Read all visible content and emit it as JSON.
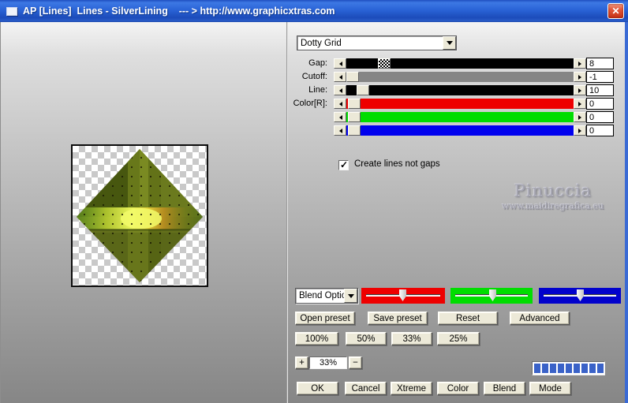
{
  "window": {
    "title": "AP [Lines]  Lines - SilverLining    --- > http://www.graphicxtras.com",
    "close_glyph": "✕"
  },
  "filter": {
    "selected": "Dotty Grid"
  },
  "sliders": {
    "rows": [
      {
        "label": "Gap:",
        "value": "8",
        "track_color": "#000000"
      },
      {
        "label": "Cutoff:",
        "value": "-1",
        "track_color": "#858585"
      },
      {
        "label": "Line:",
        "value": "10",
        "track_color": "#000000"
      },
      {
        "label": "Color[R]:",
        "value": "0",
        "track_color": "#ee0000"
      },
      {
        "label": "",
        "value": "0",
        "track_color": "#00dd00"
      },
      {
        "label": "",
        "value": "0",
        "track_color": "#0000ee"
      }
    ]
  },
  "options": {
    "create_lines_label": "Create lines not gaps",
    "checked": true
  },
  "watermark": {
    "name": "Pinuccia",
    "site": "www.maidiregrafica.eu"
  },
  "blend": {
    "dropdown_label": "Blend Optio",
    "channel_colors": [
      "#ee0000",
      "#00dd00",
      "#0202cc"
    ]
  },
  "presets": {
    "open": "Open preset",
    "save": "Save preset",
    "reset": "Reset",
    "advanced": "Advanced"
  },
  "zoom_presets": [
    "100%",
    "50%",
    "33%",
    "25%"
  ],
  "zoom_control": {
    "plus": "+",
    "value": "33%",
    "minus": "−"
  },
  "progress": {
    "segments": 9,
    "color": "#3a62c8"
  },
  "actions": [
    "OK",
    "Cancel",
    "Xtreme",
    "Color",
    "Blend",
    "Mode"
  ]
}
